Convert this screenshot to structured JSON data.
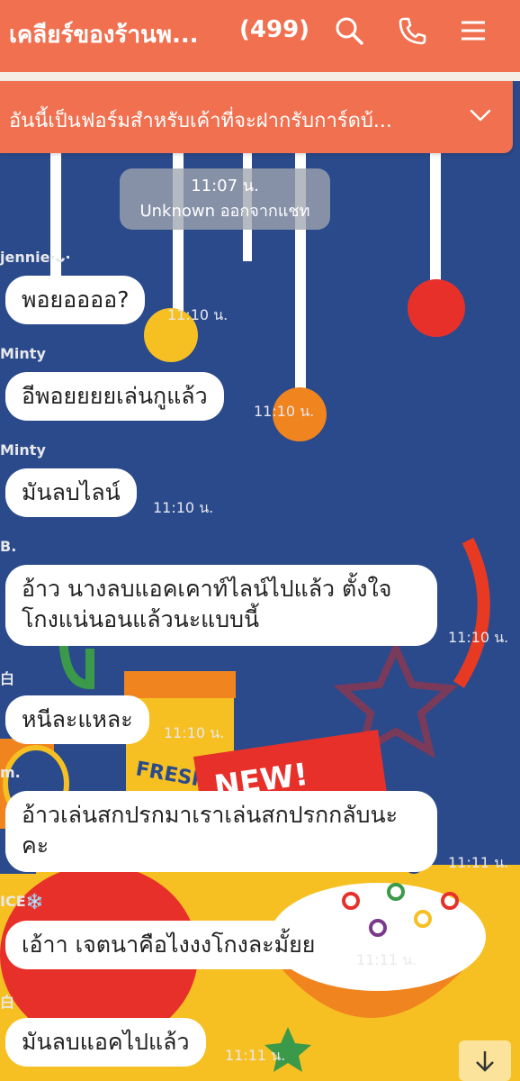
{
  "header": {
    "title": "เคลียร์ของร้านพ...",
    "count": "(499)",
    "search_icon": "search-icon",
    "call_icon": "phone-icon",
    "menu_icon": "menu-icon"
  },
  "announcement": {
    "text": "อันนี้เป็นฟอร์มสำหรับเค้าที่จะฝากรับการ์ดบ้...",
    "icon": "chevron-down-icon"
  },
  "system_message": {
    "time": "11:07 น.",
    "text": "Unknown ออกจากแชท"
  },
  "messages": [
    {
      "sender": "jennie·ᴗ·",
      "text": "พอยออออ?",
      "time": "11:10 น."
    },
    {
      "sender": "Minty",
      "text": "อีพอยยยยเล่นกูแล้ว",
      "time": "11:10 น."
    },
    {
      "sender": "Minty",
      "text": "มันลบไลน์",
      "time": "11:10 น."
    },
    {
      "sender": "B.",
      "text_lines": [
        "อ้าว นางลบแอคเคาท์ไลน์ไปแล้ว ตั้งใจ",
        "โกงแน่นอนแล้วนะแบบนี้"
      ],
      "time": "11:10 น."
    },
    {
      "sender": "白",
      "text": "หนีละแหละ",
      "time": "11:10 น."
    },
    {
      "sender": "m.",
      "text_lines": [
        "อ้าวเล่นสกปรกมาเราเล่นสกปรกกลับนะ",
        "คะ"
      ],
      "time": "11:11 น."
    },
    {
      "sender": "ICE❄️",
      "text": "เอ้าา เจตนาคือไงงงโกงละมั้ยย",
      "time": "11:11 น."
    },
    {
      "sender": "白",
      "text": "มันลบแอคไปแล้ว",
      "time": "11:11 น."
    }
  ],
  "background_art": {
    "sticker_text": "NEW!",
    "box_text": "FRESH"
  },
  "colors": {
    "header": "#f07050",
    "background": "#2a4a8c",
    "bubble": "#ffffff"
  }
}
